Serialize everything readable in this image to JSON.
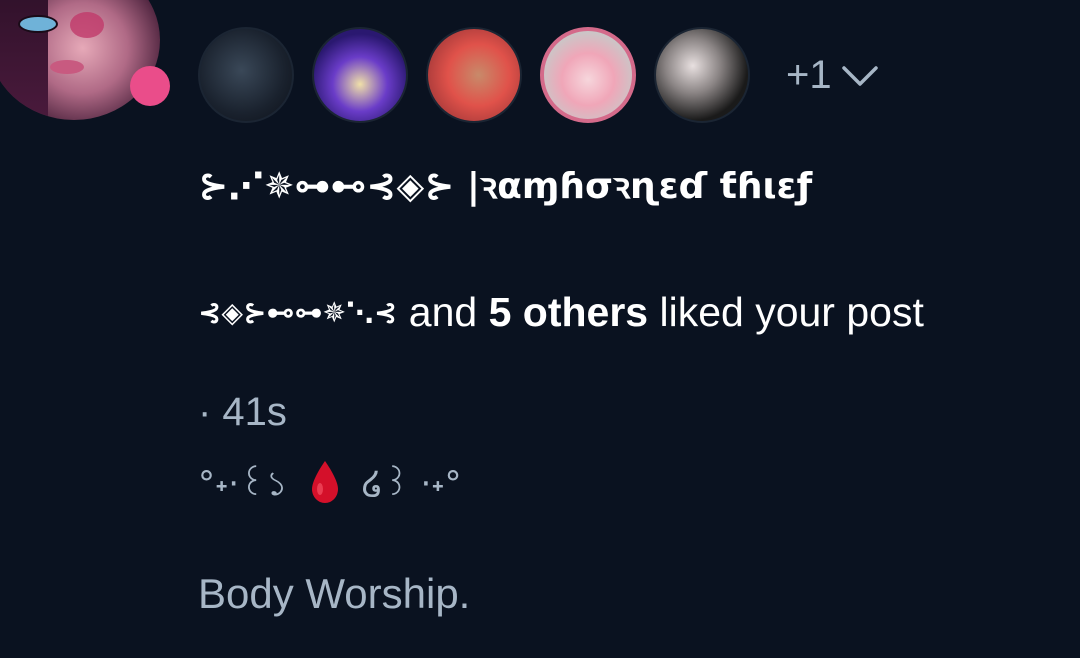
{
  "notification": {
    "group_title": "⊱⋰✵⊶⊷⊰◈⊱ |ꝛαɱɦσꝛɳεɗ ƭɦιεƒ",
    "liker_name": "⊰◈⊱⊷⊶✵⋱⊰",
    "activity_middle": " and ",
    "others_count": "5 others",
    "activity_suffix": " liked your post",
    "timestamp": "· 41s",
    "deco_left": "°˖·꒰১",
    "deco_right": "໒꒱ ·˖°",
    "post_text": "Body Worship.",
    "more_avatars": "+1"
  },
  "icons": {
    "drop": "blood-drop-icon",
    "chevron": "chevron-down-icon"
  },
  "colors": {
    "background": "#0a1220",
    "primary_text": "#ffffff",
    "secondary_text": "#a7b6c6",
    "badge": "#ea4d8a",
    "drop": "#d4102a"
  }
}
